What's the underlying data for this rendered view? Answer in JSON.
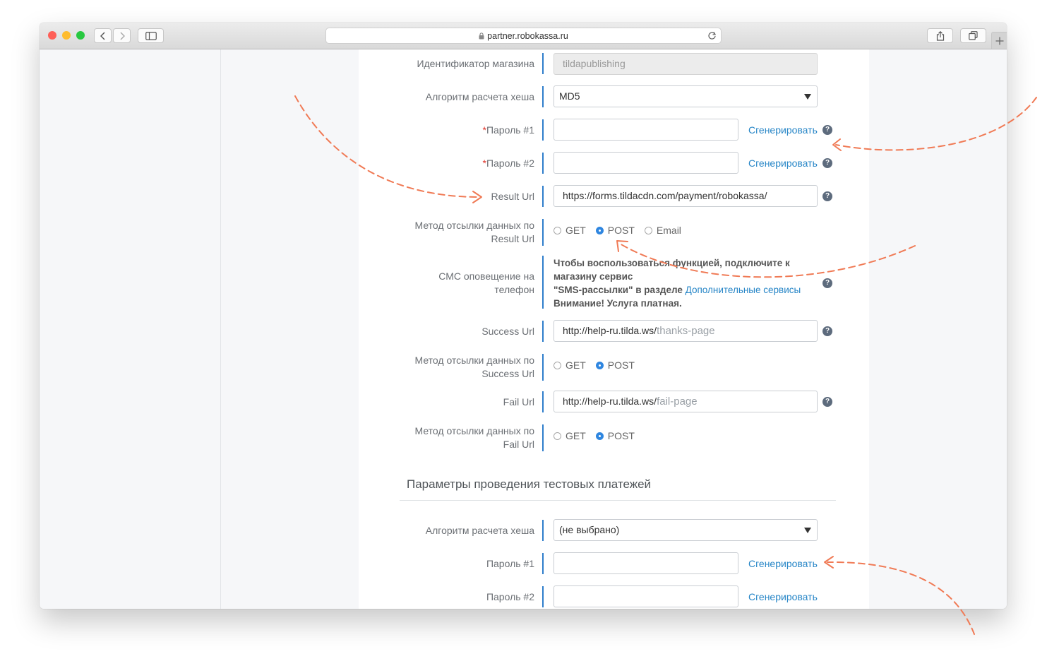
{
  "browser": {
    "url": "partner.robokassa.ru",
    "lights": {
      "close": "#fe5f57",
      "minimize": "#febc2e",
      "zoom": "#28c840"
    }
  },
  "form": {
    "shop_id_label": "Идентификатор магазина",
    "shop_id_value": "tildapublishing",
    "hash_label": "Алгоритм расчета хеша",
    "hash_value": "MD5",
    "password1_label": "Пароль #1",
    "password2_label": "Пароль #2",
    "required_mark": "*",
    "generate_label": "Сгенерировать",
    "help_glyph": "?",
    "result_url_label": "Result Url",
    "result_url_value": "https://forms.tildacdn.com/payment/robokassa/",
    "result_method_label_1": "Метод отсылки данных по",
    "result_method_label_2": "Result Url",
    "radio_get": "GET",
    "radio_post": "POST",
    "radio_email": "Email",
    "sms_label_1": "СМС оповещение на",
    "sms_label_2": "телефон",
    "sms_text_1": "Чтобы воспользоваться функцией, подключите к магазину сервис",
    "sms_text_2": "\"SMS-рассылки\" в разделе ",
    "sms_link": "Дополнительные сервисы",
    "sms_text_3": "Внимание! Услуга платная.",
    "success_url_label": "Success Url",
    "success_url_prefix": "http://help-ru.tilda.ws/",
    "success_url_placeholder": "thanks-page",
    "success_method_label_1": "Метод отсылки данных по",
    "success_method_label_2": "Success Url",
    "fail_url_label": "Fail Url",
    "fail_url_prefix": "http://help-ru.tilda.ws/",
    "fail_url_placeholder": "fail-page",
    "fail_method_label_1": "Метод отсылки данных по",
    "fail_method_label_2": "Fail Url"
  },
  "test_section": {
    "title": "Параметры проведения тестовых платежей",
    "hash_label": "Алгоритм расчета хеша",
    "hash_value": "(не выбрано)",
    "password1_label": "Пароль #1",
    "password2_label": "Пароль #2",
    "generate_label": "Сгенерировать"
  },
  "colors": {
    "accent": "#2f7ecb",
    "link": "#2786c7",
    "annotation_arrow": "#f07a55",
    "required": "#e0352b"
  }
}
